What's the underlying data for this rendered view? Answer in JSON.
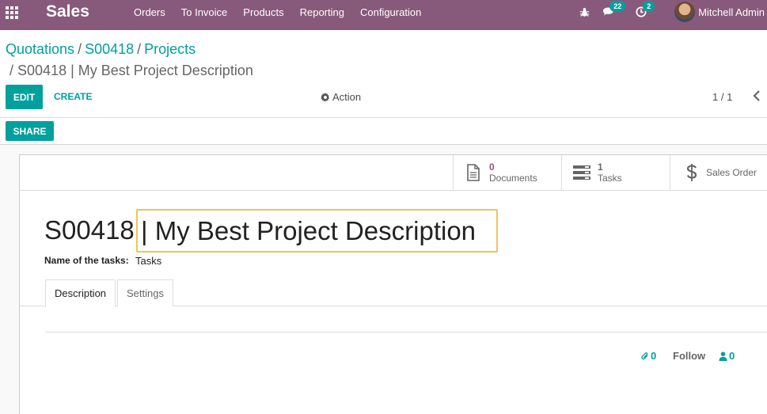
{
  "navbar": {
    "brand": "Sales",
    "menu": [
      "Orders",
      "To Invoice",
      "Products",
      "Reporting",
      "Configuration"
    ],
    "messages_count": "22",
    "activities_count": "2",
    "user_name": "Mitchell Admin"
  },
  "breadcrumb": {
    "items": [
      "Quotations",
      "S00418",
      "Projects"
    ],
    "separator": "/",
    "current": "S00418 | My Best Project Description"
  },
  "control_panel": {
    "edit_label": "EDIT",
    "create_label": "CREATE",
    "action_label": "Action",
    "share_label": "SHARE",
    "pager": "1 / 1"
  },
  "stat_buttons": {
    "documents": {
      "value": "0",
      "label": "Documents"
    },
    "tasks": {
      "value": "1",
      "label": "Tasks"
    },
    "sales_order": {
      "label": "Sales Order"
    }
  },
  "form": {
    "title_prefix": "S00418",
    "title_value": "| My Best Project Description",
    "task_name_label": "Name of the tasks:",
    "task_name_value": "Tasks"
  },
  "tabs": [
    "Description",
    "Settings"
  ],
  "chatter": {
    "attachments": "0",
    "follow_label": "Follow",
    "followers": "0"
  },
  "colors": {
    "navbar": "#875a7b",
    "primary": "#00a09d",
    "focus_border": "#f0c359"
  }
}
